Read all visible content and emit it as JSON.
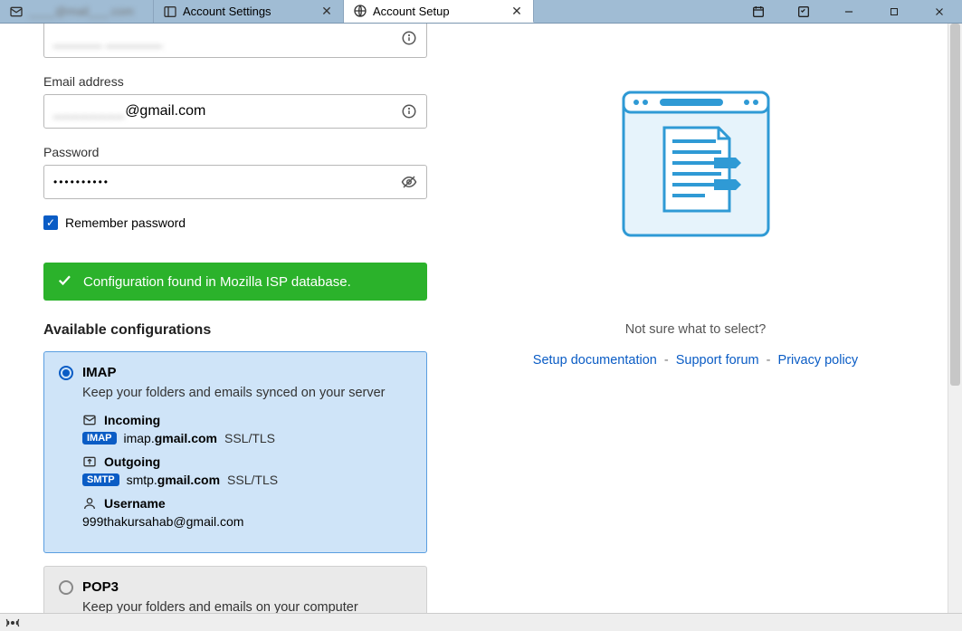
{
  "tabs": [
    {
      "label": "____@mail___.com",
      "has_close": false
    },
    {
      "label": "Account Settings",
      "has_close": true
    },
    {
      "label": "Account Setup",
      "has_close": true
    }
  ],
  "form": {
    "name_value": "______ _______",
    "email_label": "Email address",
    "email_value": "_____________@gmail.com",
    "password_label": "Password",
    "password_value": "••••••••••",
    "remember_label": "Remember password",
    "remember_checked": true
  },
  "banner": {
    "text": "Configuration found in Mozilla ISP database."
  },
  "configs": {
    "heading": "Available configurations",
    "imap": {
      "title": "IMAP",
      "sub": "Keep your folders and emails synced on your server",
      "incoming_label": "Incoming",
      "incoming_proto": "IMAP",
      "incoming_host_pre": "imap.",
      "incoming_host_bold": "gmail.com",
      "incoming_enc": "SSL/TLS",
      "outgoing_label": "Outgoing",
      "outgoing_proto": "SMTP",
      "outgoing_host_pre": "smtp.",
      "outgoing_host_bold": "gmail.com",
      "outgoing_enc": "SSL/TLS",
      "username_label": "Username",
      "username_value": "999thakursahab@gmail.com"
    },
    "pop": {
      "title": "POP3",
      "sub": "Keep your folders and emails on your computer"
    }
  },
  "help": {
    "question": "Not sure what to select?",
    "doc": "Setup documentation",
    "forum": "Support forum",
    "privacy": "Privacy policy"
  }
}
